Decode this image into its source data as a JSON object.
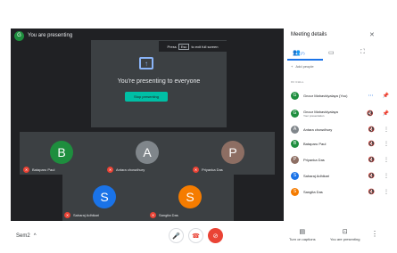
{
  "topbar": {
    "badge": "G",
    "title": "You are presenting"
  },
  "fullscreen_hint": {
    "before": "Press",
    "key": "Esc",
    "after": "to exit full screen"
  },
  "presenting": {
    "icon": "present-to-all-icon",
    "message": "You're presenting to everyone",
    "stop_label": "Stop presenting"
  },
  "tiles": [
    {
      "initial": "B",
      "name": "Bataparu Paul",
      "color": "#1e8e3e"
    },
    {
      "initial": "A",
      "name": "Antara chowdhury",
      "color": "#80868b"
    },
    {
      "initial": "P",
      "name": "Priyanka Das",
      "color": "#8d6e63"
    },
    {
      "initial": "S",
      "name": "Saharaj Adhikari",
      "color": "#1a73e8"
    },
    {
      "initial": "S",
      "name": "Sangita Das",
      "color": "#f57c00"
    }
  ],
  "bottom": {
    "meeting_code": "Sem2",
    "caret": "^",
    "captions_label": "Turn on captions",
    "presenting_label": "You are presenting",
    "more": "⋮"
  },
  "panel": {
    "title": "Meeting details",
    "close": "✕",
    "people_count": "(7)",
    "add_people": "Add people",
    "in_call": "IN CALL",
    "participants": [
      {
        "initial": "G",
        "name": "Gnour Mahavidyalaya (You)",
        "sub": "",
        "color": "#1e8e3e"
      },
      {
        "initial": "G",
        "name": "Gnour Mahavidyalaya",
        "sub": "Your presentation",
        "color": "#1e8e3e"
      },
      {
        "initial": "A",
        "name": "Antara chowdhury",
        "sub": "",
        "color": "#80868b"
      },
      {
        "initial": "B",
        "name": "Bataparu Paul",
        "sub": "",
        "color": "#1e8e3e"
      },
      {
        "initial": "P",
        "name": "Priyanka Das",
        "sub": "",
        "color": "#8d6e63"
      },
      {
        "initial": "S",
        "name": "Saharaj Adhikari",
        "sub": "",
        "color": "#1a73e8"
      },
      {
        "initial": "S",
        "name": "Sangita Das",
        "sub": "",
        "color": "#f57c00"
      }
    ]
  },
  "colors": {
    "accent": "#1a73e8",
    "danger": "#ea4335",
    "stop_button": "#00bfa5",
    "dark": "#202124"
  }
}
